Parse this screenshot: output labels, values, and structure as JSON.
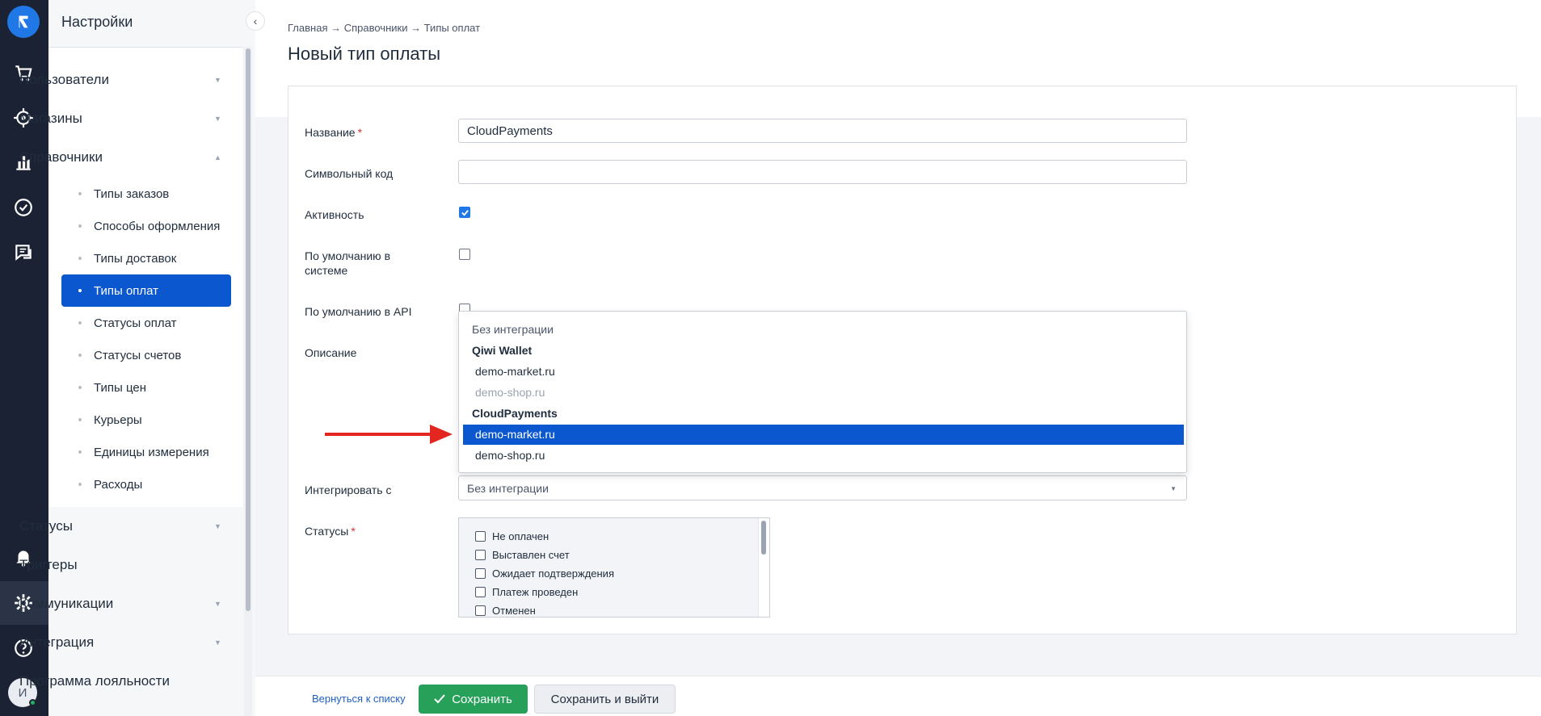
{
  "sidebar": {
    "title": "Настройки",
    "sections": [
      {
        "label": "Пользователи"
      },
      {
        "label": "Магазины"
      },
      {
        "label": "Справочники"
      },
      {
        "label": "Статусы"
      },
      {
        "label": "Триггеры"
      },
      {
        "label": "Коммуникации"
      },
      {
        "label": "Интеграция"
      },
      {
        "label": "Программа лояльности"
      }
    ],
    "sub_items": [
      {
        "label": "Типы заказов"
      },
      {
        "label": "Способы оформления"
      },
      {
        "label": "Типы доставок"
      },
      {
        "label": "Типы оплат",
        "active": true
      },
      {
        "label": "Статусы оплат"
      },
      {
        "label": "Статусы счетов"
      },
      {
        "label": "Типы цен"
      },
      {
        "label": "Курьеры"
      },
      {
        "label": "Единицы измерения"
      },
      {
        "label": "Расходы"
      }
    ]
  },
  "rail": {
    "avatar_letter": "И",
    "icons": [
      "logo-icon",
      "cart-icon",
      "target-icon",
      "analytics-icon",
      "tasks-icon",
      "chat-icon",
      "bell-icon",
      "gear-icon",
      "help-icon"
    ]
  },
  "breadcrumb": "Главная → Справочники → Типы оплат",
  "page_title": "Новый тип оплаты",
  "form": {
    "name_label": "Название",
    "name_value": "CloudPayments",
    "code_label": "Символьный код",
    "code_value": "",
    "active_label": "Активность",
    "active_checked": true,
    "default_system_label": "По умолчанию в системе",
    "default_system_checked": false,
    "default_api_label": "По умолчанию в API",
    "default_api_checked": false,
    "description_label": "Описание",
    "integrate_label": "Интегрировать с",
    "integrate_value": "Без интеграции",
    "statuses_label": "Статусы"
  },
  "dropdown": {
    "none_option": "Без интеграции",
    "groups": [
      {
        "label": "Qiwi Wallet",
        "options": [
          {
            "label": "demo-market.ru",
            "disabled": false
          },
          {
            "label": "demo-shop.ru",
            "disabled": true
          }
        ]
      },
      {
        "label": "CloudPayments",
        "options": [
          {
            "label": "demo-market.ru",
            "selected": true
          },
          {
            "label": "demo-shop.ru",
            "selected": false
          }
        ]
      }
    ]
  },
  "statuses": [
    {
      "label": "Не оплачен"
    },
    {
      "label": "Выставлен счет"
    },
    {
      "label": "Ожидает подтверждения"
    },
    {
      "label": "Платеж проведен"
    },
    {
      "label": "Отменен"
    }
  ],
  "footer": {
    "back_label": "Вернуться к списку",
    "save_label": "Сохранить",
    "save_exit_label": "Сохранить и выйти"
  },
  "colors": {
    "rail_bg": "#1b2233",
    "accent": "#0b57d0",
    "save_green": "#27a05a",
    "required": "#e0322f",
    "arrow": "#e3261f"
  }
}
